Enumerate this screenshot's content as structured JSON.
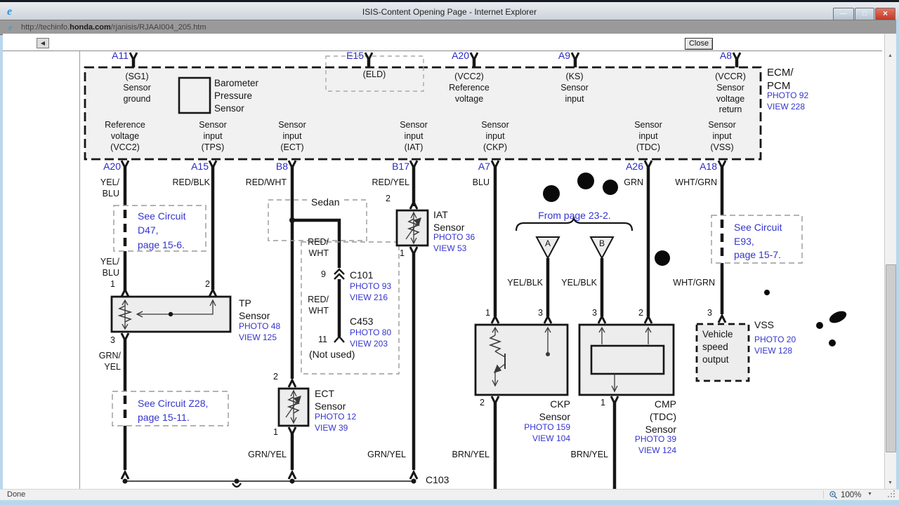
{
  "window": {
    "title": "ISIS-Content Opening Page - Internet Explorer",
    "url_prefix": "http://techinfo.",
    "url_domain": "honda.com",
    "url_path": "/rjanisis/RJAAI004_205.htm",
    "icons": {
      "ie": "e",
      "back": "◀",
      "minimize": "—",
      "maximize": "□",
      "close": "×",
      "scroll_up": "▲",
      "scroll_down": "▼",
      "caret": "▼"
    }
  },
  "toolbar": {
    "close_label": "Close"
  },
  "status": {
    "left": "Done",
    "zoom": "100%"
  },
  "colors": {
    "diagram_link_blue": "#3434cf",
    "titlebar_close_red": "#bf3425",
    "window_frame_blue": "#b9d7ec"
  },
  "diagram": {
    "ecm": {
      "pin_a11": "A11",
      "pin_e15": "E15",
      "pin_a20": "A20",
      "pin_a9": "A9",
      "pin_a8": "A8",
      "sg1": "(SG1)\nSensor\nground",
      "baro": "Barometer\nPressure\nSensor",
      "eld": "(ELD)",
      "vcc2": "(VCC2)\nReference\nvoltage",
      "ks": "(KS)\nSensor\ninput",
      "vccr": "(VCCR)\nSensor\nvoltage\nreturn",
      "in_vcc2": "Reference\nvoltage\n(VCC2)",
      "in_tps": "Sensor\ninput\n(TPS)",
      "in_ect": "Sensor\ninput\n(ECT)",
      "in_iat": "Sensor\ninput\n(IAT)",
      "in_ckp": "Sensor\ninput\n(CKP)",
      "in_tdc": "Sensor\ninput\n(TDC)",
      "in_vss": "Sensor\ninput\n(VSS)",
      "name": "ECM/\nPCM",
      "ref": "PHOTO 92\nVIEW 228"
    },
    "pins": {
      "a20": "A20",
      "a15": "A15",
      "b8": "B8",
      "b17": "B17",
      "a7": "A7",
      "a26": "A26",
      "a18": "A18"
    },
    "wires": {
      "yelblu1": "YEL/\nBLU",
      "redblk": "RED/BLK",
      "redwht": "RED/WHT",
      "redyel": "RED/YEL",
      "blu": "BLU",
      "grn": "GRN",
      "whtgrn1": "WHT/GRN",
      "yelblu2": "YEL/\nBLU",
      "grnyel_l1": "GRN/\nYEL",
      "grnyel_l2": "GRN/\nYEL",
      "redwht_s1": "RED/\nWHT",
      "redwht_s2": "RED/\nWHT",
      "yelblk_a": "YEL/BLK",
      "yelblk_b": "YEL/BLK",
      "whtgrn2": "WHT/GRN",
      "grnyel_m1": "GRN/YEL",
      "grnyel_m2": "GRN/YEL",
      "brnyel1": "BRN/YEL",
      "brnyel2": "BRN/YEL"
    },
    "notes": {
      "d47": "See Circuit\nD47,\npage 15-6.",
      "z28": "See Circuit Z28,\npage 15-11.",
      "e93": "See Circuit\nE93,\npage 15-7.",
      "from_page": "From page 23-2.",
      "sedan": "Sedan",
      "not_used": "(Not used)"
    },
    "tp": {
      "p1": "1",
      "p2": "2",
      "p3": "3",
      "name": "TP\nSensor",
      "ref": "PHOTO 48\nVIEW 125"
    },
    "iat": {
      "p2": "2",
      "p1": "1",
      "name": "IAT\nSensor",
      "ref": "PHOTO 36\nVIEW 53"
    },
    "ect": {
      "p2": "2",
      "p1": "1",
      "name": "ECT\nSensor",
      "ref": "PHOTO 12\nVIEW 39"
    },
    "ckp": {
      "p1": "1",
      "p3": "3",
      "p2": "2",
      "name": "CKP\nSensor",
      "ref": "PHOTO 159\nVIEW 104"
    },
    "cmp": {
      "p3": "3",
      "p2": "2",
      "p1": "1",
      "name": "CMP\n(TDC)\nSensor",
      "ref": "PHOTO 39\nVIEW 124"
    },
    "vss": {
      "p3": "3",
      "box": "Vehicle\nspeed\noutput",
      "name": "VSS",
      "ref": "PHOTO 20\nVIEW 128"
    },
    "conn": {
      "p9": "9",
      "c101": "C101",
      "c101_ref": "PHOTO 93\nVIEW 216",
      "c453": "C453",
      "c453_ref": "PHOTO 80\nVIEW 203",
      "p11": "11",
      "c103": "C103"
    },
    "tri": {
      "a": "A",
      "b": "B"
    }
  }
}
